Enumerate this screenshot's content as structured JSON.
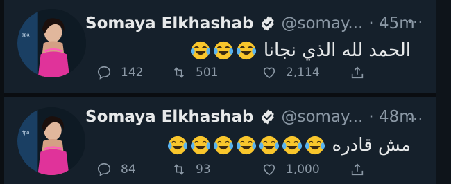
{
  "tweets": [
    {
      "name": "Somaya Elkhashab",
      "handle": "@somay...",
      "time": "· 45m",
      "more": "···",
      "text": "الحمد لله الذي نجانا",
      "emoji_count": 3,
      "emoji_icon": "face-with-tears-of-joy-icon",
      "replies": "142",
      "retweets": "501",
      "likes": "2,114"
    },
    {
      "name": "Somaya Elkhashab",
      "handle": "@somay...",
      "time": "· 48m",
      "more": "···",
      "text": "مش قادره",
      "emoji_count": 7,
      "emoji_icon": "face-with-tears-of-joy-icon",
      "replies": "84",
      "retweets": "93",
      "likes": "1,000"
    }
  ],
  "colors": {
    "background": "#15202b",
    "verified": "#e7e9ea",
    "secondary_text": "#8b98a5",
    "emoji_face": "#f9c62c"
  }
}
